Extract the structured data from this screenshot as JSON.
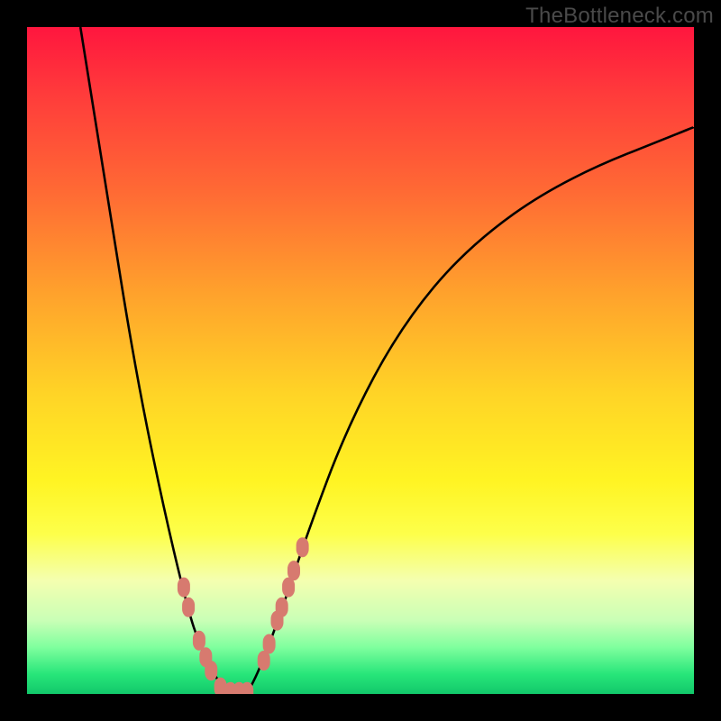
{
  "watermark": "TheBottleneck.com",
  "colors": {
    "curve_stroke": "#000000",
    "marker_fill": "#d77a6f",
    "marker_stroke": "#b85e55",
    "frame_bg": "#000000"
  },
  "chart_data": {
    "type": "line",
    "title": "",
    "xlabel": "",
    "ylabel": "",
    "xlim": [
      0,
      100
    ],
    "ylim": [
      0,
      100
    ],
    "grid": false,
    "series": [
      {
        "name": "left-branch",
        "x": [
          8,
          12,
          16,
          20,
          24,
          26,
          28,
          30
        ],
        "y": [
          100,
          75,
          50,
          30,
          13,
          7,
          3,
          0
        ]
      },
      {
        "name": "right-branch",
        "x": [
          33,
          35,
          38,
          42,
          48,
          56,
          66,
          80,
          100
        ],
        "y": [
          0,
          4,
          12,
          24,
          40,
          55,
          67,
          77,
          85
        ]
      }
    ],
    "markers_left": [
      {
        "x": 23.5,
        "y": 16
      },
      {
        "x": 24.2,
        "y": 13
      },
      {
        "x": 25.8,
        "y": 8
      },
      {
        "x": 26.8,
        "y": 5.5
      },
      {
        "x": 27.6,
        "y": 3.5
      },
      {
        "x": 29.0,
        "y": 1
      },
      {
        "x": 30.5,
        "y": 0.3
      },
      {
        "x": 31.8,
        "y": 0.3
      },
      {
        "x": 33.0,
        "y": 0.3
      }
    ],
    "markers_right": [
      {
        "x": 35.5,
        "y": 5
      },
      {
        "x": 36.3,
        "y": 7.5
      },
      {
        "x": 37.5,
        "y": 11
      },
      {
        "x": 38.2,
        "y": 13
      },
      {
        "x": 39.2,
        "y": 16
      },
      {
        "x": 40.0,
        "y": 18.5
      },
      {
        "x": 41.3,
        "y": 22
      }
    ]
  }
}
